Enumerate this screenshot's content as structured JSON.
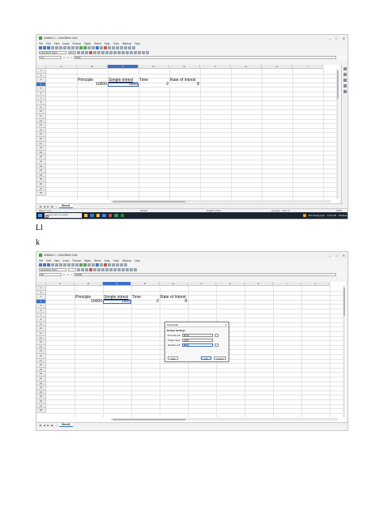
{
  "app": {
    "window_title": "Untitled 1 - LibreOffice Calc",
    "menus": [
      "File",
      "Edit",
      "View",
      "Insert",
      "Format",
      "Styles",
      "Sheet",
      "Data",
      "Tools",
      "Window",
      "Help"
    ],
    "window_controls": [
      "–",
      "□",
      "✕"
    ]
  },
  "shot1": {
    "font_name": "Liberation Sans",
    "font_size": "10 pt",
    "name_box": "C4",
    "formula_value": "1600",
    "columns": [
      "A",
      "B",
      "C",
      "D",
      "E",
      "F",
      "G",
      "H",
      "I"
    ],
    "rows": [
      "1",
      "2",
      "3",
      "4",
      "5",
      "6",
      "7",
      "8",
      "9",
      "10",
      "11",
      "12",
      "13",
      "14",
      "15",
      "16",
      "17",
      "18",
      "19",
      "20",
      "21",
      "22",
      "23",
      "24",
      "25",
      "26",
      "27",
      "28",
      "29",
      "30"
    ],
    "cells": {
      "b3": "Principle",
      "c3": "Simple intrest",
      "d3": "Time",
      "e3": "Rate of Intrest",
      "b4": "10000",
      "c4": "1600",
      "d4": "2",
      "e4": "8"
    },
    "sheet_tab": "Sheet1",
    "status": {
      "sheet": "Sheet 1 of 1",
      "style": "Default",
      "language": "English (USA)",
      "summary": "Average: ; Sum: 0",
      "zoom": "100%"
    },
    "taskbar": {
      "search_placeholder": "Type here to search",
      "weather": "29°C  Mostly clear",
      "time": "11:51 PM",
      "date": "5/3/2024"
    }
  },
  "caption": "Ll",
  "caption2": "k",
  "shot2": {
    "font_name": "Liberation Sans",
    "name_box": "B4",
    "formula_value": "10000",
    "columns": [
      "A",
      "B",
      "C",
      "D",
      "E",
      "F",
      "G",
      "H",
      "I",
      "J"
    ],
    "rows": [
      "1",
      "2",
      "3",
      "4",
      "5",
      "6",
      "7",
      "8",
      "9",
      "10",
      "11",
      "12",
      "13",
      "14",
      "15",
      "16",
      "17",
      "18",
      "19",
      "20",
      "21",
      "22",
      "23",
      "24",
      "25",
      "26",
      "27",
      "28",
      "29",
      "30"
    ],
    "cells": {
      "b3": "Principle",
      "c3": "Simple intrest",
      "d3": "Time",
      "e3": "Rate of Intrest",
      "b4": "10000",
      "c4": "1600",
      "d4": "2",
      "e4": "8"
    },
    "sheet_tab": "Sheet1",
    "dialog": {
      "title": "Goal Seek",
      "section": "Default Settings",
      "formula_cell_label": "Formula cell:",
      "formula_cell_value": "$C$4",
      "target_value_label": "Target value:",
      "target_value_value": "1600",
      "variable_cell_label": "Variable cell:",
      "variable_cell_value": "$B$4",
      "help": "Help",
      "ok": "OK",
      "cancel": "Cancel"
    }
  }
}
